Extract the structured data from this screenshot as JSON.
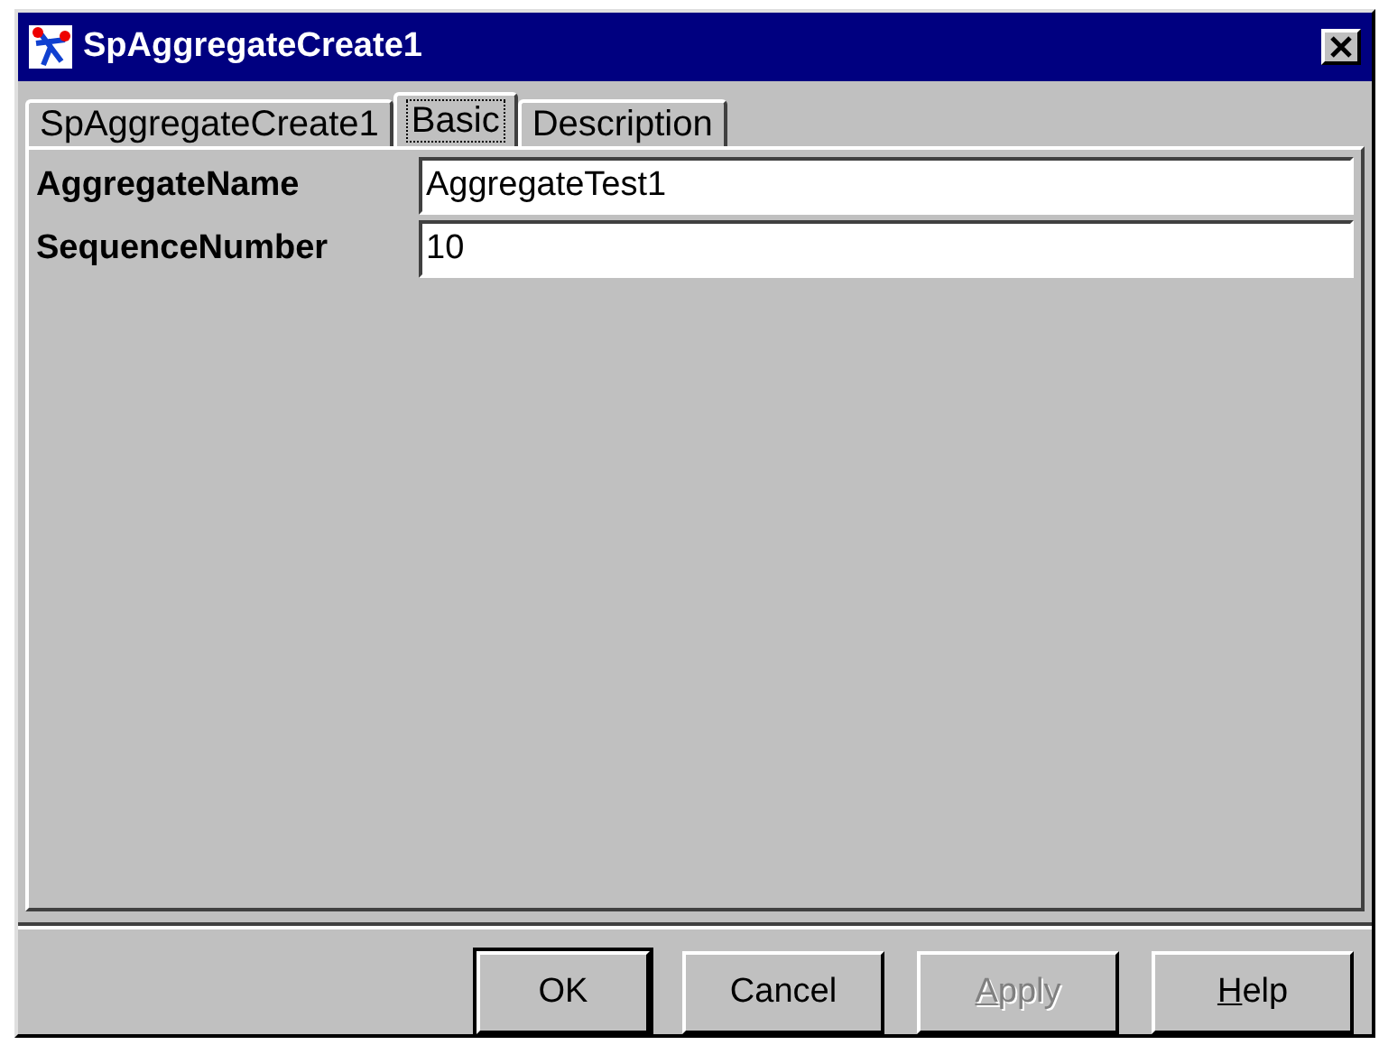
{
  "window": {
    "title": "SpAggregateCreate1"
  },
  "tabs": [
    {
      "label": "SpAggregateCreate1",
      "selected": false
    },
    {
      "label": "Basic",
      "selected": true
    },
    {
      "label": "Description",
      "selected": false
    }
  ],
  "fields": [
    {
      "label": "AggregateName",
      "value": "AggregateTest1"
    },
    {
      "label": "SequenceNumber",
      "value": "10"
    }
  ],
  "buttons": [
    {
      "label": "OK",
      "default": true,
      "disabled": false,
      "mnemonic": false
    },
    {
      "label": "Cancel",
      "default": false,
      "disabled": false,
      "mnemonic": false
    },
    {
      "label": "Apply",
      "default": false,
      "disabled": true,
      "mnemonic": true
    },
    {
      "label": "Help",
      "default": false,
      "disabled": false,
      "mnemonic": true
    }
  ]
}
